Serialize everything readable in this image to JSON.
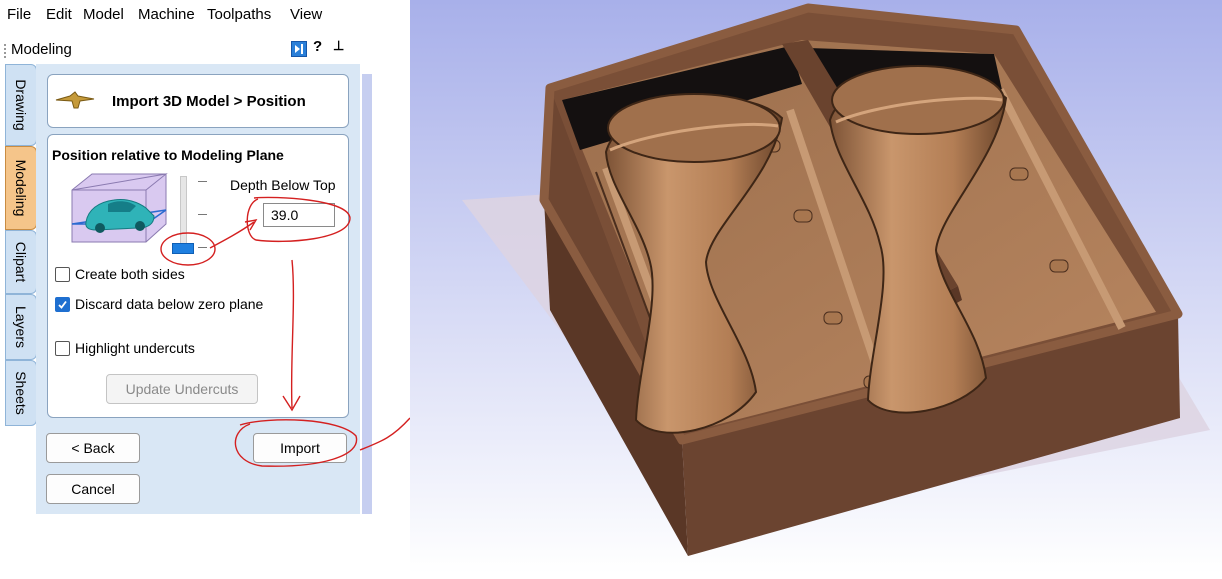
{
  "menu": [
    "File",
    "Edit",
    "Model",
    "Machine",
    "Toolpaths",
    "View"
  ],
  "panel": {
    "title": "Modeling"
  },
  "side_tabs": [
    "Drawing",
    "Modeling",
    "Clipart",
    "Layers",
    "Sheets"
  ],
  "header": {
    "title": "Import 3D Model > Position"
  },
  "section": {
    "title": "Position relative to Modeling Plane"
  },
  "depth": {
    "label": "Depth Below Top",
    "value": "39.0"
  },
  "options": {
    "create_both_sides": {
      "label": "Create both sides",
      "checked": false
    },
    "discard_below_zero": {
      "label": "Discard data below zero plane",
      "checked": true
    },
    "highlight_undercuts": {
      "label": "Highlight undercuts",
      "checked": false
    }
  },
  "buttons": {
    "update_undercuts": "Update Undercuts",
    "back": "< Back",
    "import": "Import",
    "cancel": "Cancel"
  },
  "colors": {
    "annotation": "#d42020",
    "viewport_top": "#a8b0ea",
    "viewport_bottom": "#ffffff",
    "wood": "#b9855e",
    "box_wall": "#6e4631"
  }
}
